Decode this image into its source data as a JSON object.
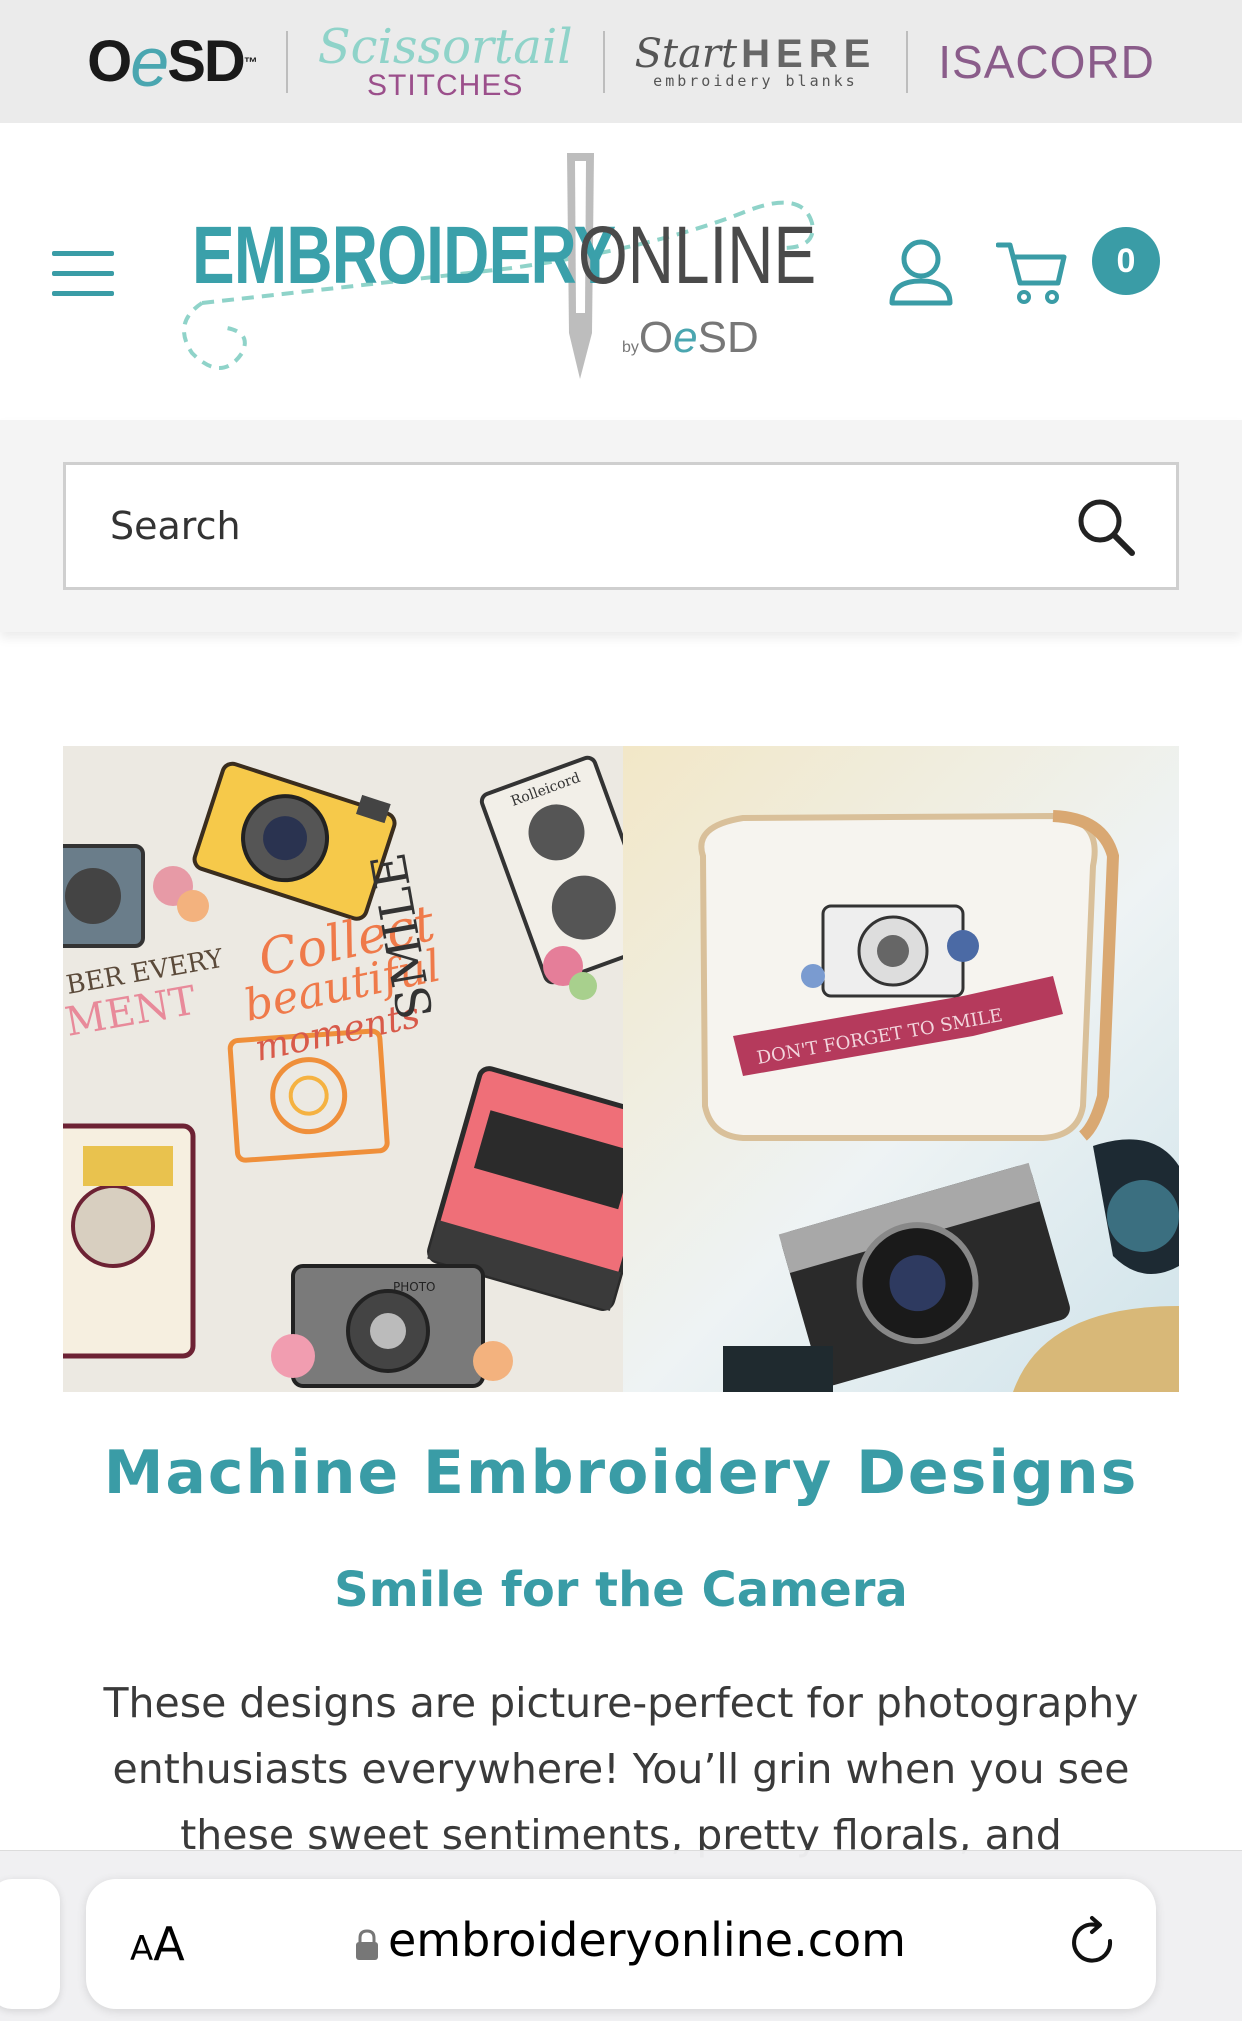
{
  "brands": {
    "oesd": {
      "o": "O",
      "e": "e",
      "sd": "SD",
      "tm": "™"
    },
    "scissortail": {
      "top": "Scissortail",
      "bottom": "STITCHES"
    },
    "starthere": {
      "start": "Start",
      "here": "HERE",
      "sub": "embroidery blanks"
    },
    "isacord": "ISACORD"
  },
  "header": {
    "logo": {
      "word1": "EMBROIDERY",
      "word2": "ONLINE",
      "by": "by",
      "o": "O",
      "e": "e",
      "sd": "SD"
    },
    "cart_count": "0"
  },
  "search": {
    "placeholder": "Search"
  },
  "hero": {
    "texts": {
      "member_top": "BER EVERY",
      "member_bottom": "MENT",
      "collect": "Collect",
      "beautiful": "beautiful",
      "moments": "moments",
      "smile": "SMILE",
      "rolleicord": "Rolleicord",
      "photo": "PHOTO",
      "ribbon": "DON'T FORGET TO SMILE"
    }
  },
  "content": {
    "title": "Machine Embroidery Designs",
    "subtitle": "Smile for the Camera",
    "body_line1": "These designs are picture-perfect for photography",
    "body_line2": "enthusiasts everywhere! You’ll grin when you see",
    "body_line3": "these sweet sentiments, pretty florals, and"
  },
  "browser": {
    "aa_small": "A",
    "aa_large": "A",
    "url": "embroideryonline.com"
  },
  "colors": {
    "teal": "#3a9ca6",
    "purple": "#8a5c8a",
    "mint": "#8fd3c9"
  }
}
